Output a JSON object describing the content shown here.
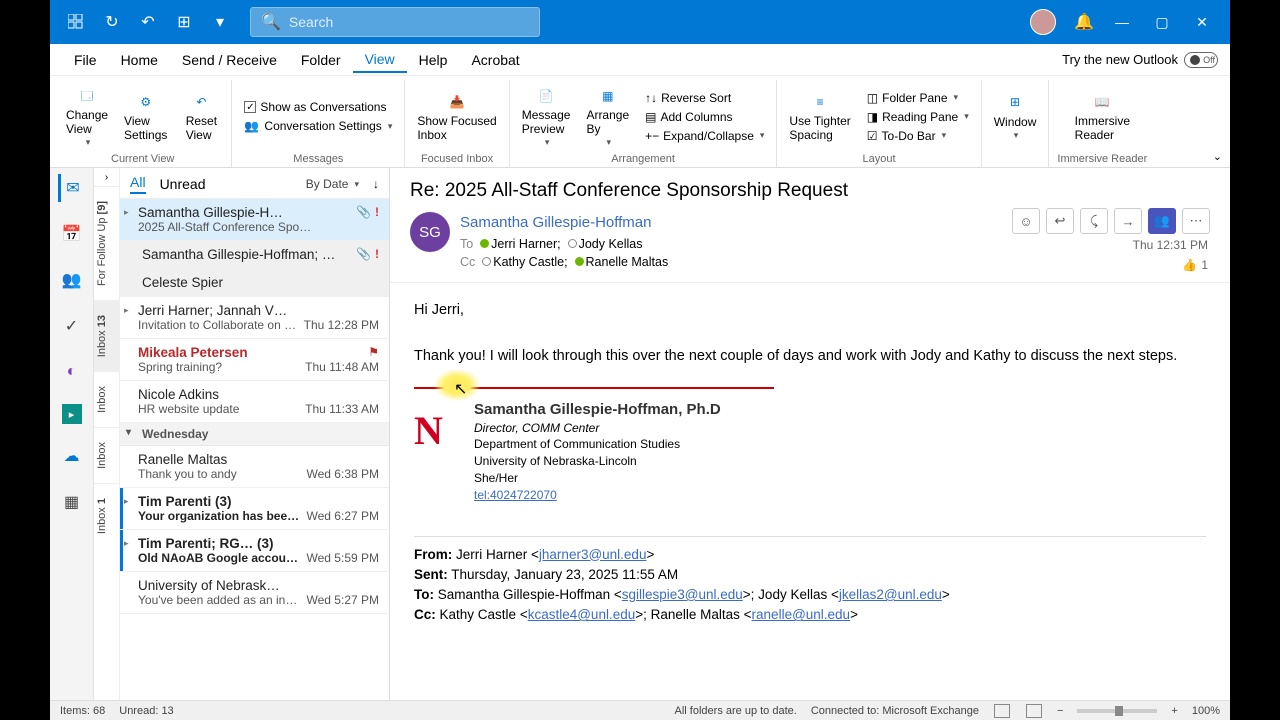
{
  "titlebar": {
    "search_placeholder": "Search"
  },
  "menu": {
    "file": "File",
    "home": "Home",
    "sendrecv": "Send / Receive",
    "folder": "Folder",
    "view": "View",
    "help": "Help",
    "acrobat": "Acrobat"
  },
  "try_new": {
    "label": "Try the new Outlook",
    "state": "Off"
  },
  "ribbon": {
    "current_view": {
      "change_view": "Change\nView",
      "view_settings": "View\nSettings",
      "reset_view": "Reset\nView",
      "group": "Current View"
    },
    "messages": {
      "show_conv": "Show as Conversations",
      "conv_settings": "Conversation Settings",
      "group": "Messages"
    },
    "focused_inbox": {
      "btn": "Show Focused\nInbox",
      "group": "Focused Inbox"
    },
    "arrangement": {
      "msg_preview": "Message\nPreview",
      "arrange_by": "Arrange\nBy",
      "reverse": "Reverse Sort",
      "add_cols": "Add Columns",
      "expand": "Expand/Collapse",
      "group": "Arrangement"
    },
    "layout": {
      "tighter": "Use Tighter\nSpacing",
      "folder_pane": "Folder Pane",
      "reading_pane": "Reading Pane",
      "todo_bar": "To-Do Bar",
      "group": "Layout"
    },
    "window": {
      "btn": "Window",
      "group": ""
    },
    "immersive": {
      "btn": "Immersive\nReader",
      "group": "Immersive Reader"
    }
  },
  "vtabs": {
    "followup": {
      "label": "For Follow Up",
      "count": "[9]"
    },
    "inbox1": {
      "label": "Inbox",
      "count": "13"
    },
    "inbox2": {
      "label": "Inbox"
    },
    "inbox3": {
      "label": "Inbox"
    },
    "inbox4": {
      "label": "Inbox",
      "count": "1"
    }
  },
  "list_hdr": {
    "all": "All",
    "unread": "Unread",
    "sort": "By Date"
  },
  "messages_list": [
    {
      "from": "Samantha Gillespie-H…",
      "subj": "2025 All-Staff Conference Spo…",
      "time": "",
      "attach": true,
      "bang": true,
      "selected": true,
      "caret": true
    },
    {
      "from": "Samantha Gillespie-Hoffman;  …",
      "thread_child": true,
      "attach": true,
      "bang": true
    },
    {
      "from": "Celeste Spier",
      "thread_child": true
    },
    {
      "from": "Jerri Harner;  Jannah V…",
      "subj": "Invitation to Collaborate on a …",
      "time": "Thu 12:28 PM",
      "caret": true
    },
    {
      "from": "Mikeala Petersen",
      "subj": "Spring training?",
      "time": "Thu 11:48 AM",
      "flagged": true
    },
    {
      "from": "Nicole Adkins",
      "subj": "HR website update",
      "time": "Thu 11:33 AM"
    },
    {
      "group": "Wednesday"
    },
    {
      "from": "Ranelle Maltas",
      "subj": "Thank you to andy",
      "time": "Wed 6:38 PM"
    },
    {
      "from": "Tim Parenti  (3)",
      "subj": "Your organization has been …",
      "time": "Wed 6:27 PM",
      "bold": true,
      "unread": true,
      "caret": true
    },
    {
      "from": "Tim Parenti;  RG…  (3)",
      "subj": "Old NAoAB Google accounts?",
      "time": "Wed 5:59 PM",
      "bold": true,
      "unread": true,
      "caret": true
    },
    {
      "from": "University of Nebrask…",
      "subj": "You've been added as an instr…",
      "time": "Wed 5:27 PM"
    }
  ],
  "reading": {
    "subject": "Re: 2025 All-Staff Conference Sponsorship Request",
    "initials": "SG",
    "sender": "Samantha Gillespie-Hoffman",
    "to_label": "To",
    "cc_label": "Cc",
    "to1": "Jerri Harner;",
    "to2": "Jody Kellas",
    "cc1": "Kathy Castle;",
    "cc2": "Ranelle Maltas",
    "time": "Thu 12:31 PM",
    "reaction_count": "1",
    "greeting": "Hi Jerri,",
    "body": "Thank you! I will look through this over the next couple of days and work with Jody and Kathy to discuss the next steps.",
    "sig": {
      "name": "Samantha Gillespie-Hoffman, Ph.D",
      "role": "Director, COMM Center",
      "dept": "Department of Communication Studies",
      "univ": "University of Nebraska-Lincoln",
      "pronouns": "She/Her",
      "tel": "tel:4024722070"
    },
    "quoted": {
      "from_label": "From:",
      "from_name": "Jerri Harner <",
      "from_email": "jharner3@unl.edu",
      "from_close": ">",
      "sent_label": "Sent:",
      "sent_val": "Thursday, January 23, 2025 11:55 AM",
      "to_label": "To:",
      "to_name1": "Samantha Gillespie-Hoffman <",
      "to_email1": "sgillespie3@unl.edu",
      "to_mid": ">; Jody Kellas <",
      "to_email2": "jkellas2@unl.edu",
      "to_close": ">",
      "cc_label": "Cc:",
      "cc_name1": "Kathy Castle <",
      "cc_email1": "kcastle4@unl.edu",
      "cc_mid": ">; Ranelle Maltas <",
      "cc_email2": "ranelle@unl.edu",
      "cc_close": ">"
    }
  },
  "status": {
    "items": "Items: 68",
    "unread": "Unread: 13",
    "sync": "All folders are up to date.",
    "conn": "Connected to: Microsoft Exchange",
    "zoom": "100%"
  }
}
